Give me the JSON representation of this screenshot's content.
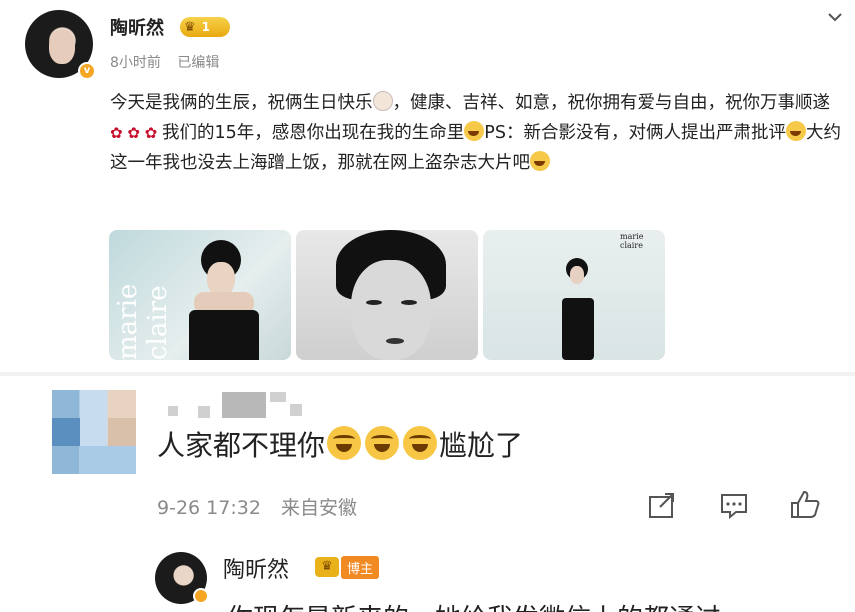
{
  "post": {
    "author": "陶昕然",
    "level": "1",
    "time": "8小时前",
    "edited": "已编辑",
    "text_parts": {
      "p1": "今天是我俩的生辰，祝俩生日快乐",
      "p2": "，健康、吉祥、如意，祝你拥有爱与自由，祝你万事顺遂",
      "p3": "我们的15年，感恩你出现在我的生命里",
      "p4": "PS：新合影没有，对俩人提出严肃批评",
      "p5": "大约这一年我也没去上海蹭上饭，那就在网上盗杂志大片吧"
    },
    "photos": {
      "mag1": "marie claire",
      "mag3": "marie claire"
    }
  },
  "comment": {
    "text": "人家都不理你",
    "text_tail": "尴尬了",
    "date": "9-26 17:32",
    "source": "来自安徽"
  },
  "reply": {
    "author": "陶昕然",
    "badge": "博主",
    "text": "你现怎是新来的，她给我发微信上的都通过"
  },
  "icons": {
    "chevron": "chevron-down-icon",
    "share": "share-icon",
    "comment": "comment-icon",
    "like": "like-icon"
  },
  "colors": {
    "accent_gold": "#f5a623",
    "meta_gray": "#8a8a8a",
    "text": "#222222"
  }
}
